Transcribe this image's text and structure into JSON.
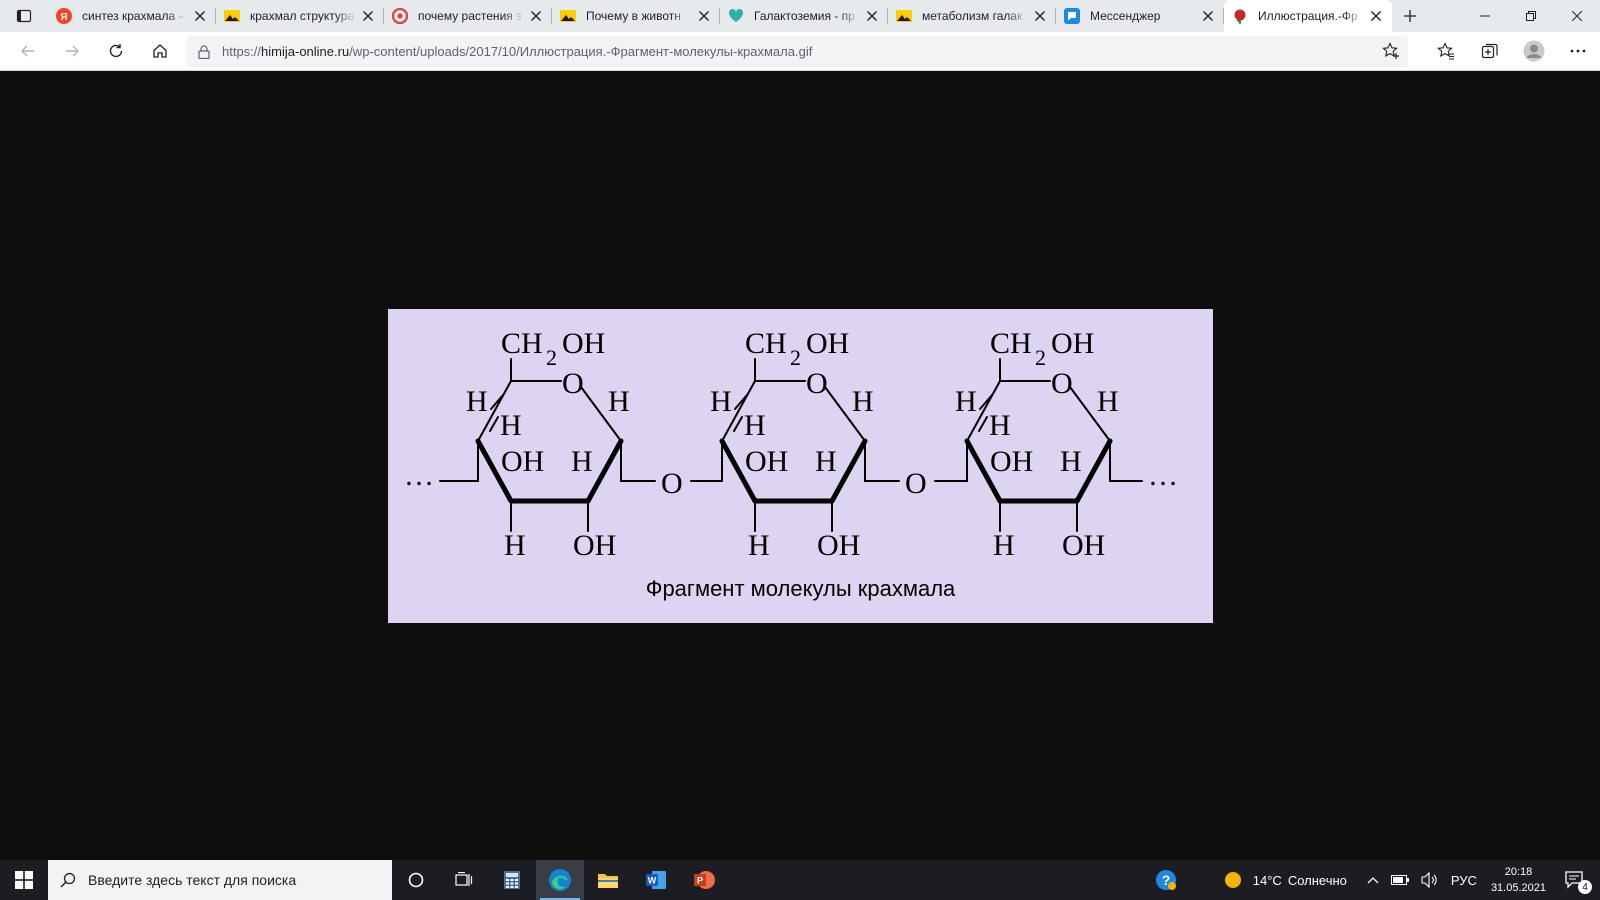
{
  "browser": {
    "tabs": [
      {
        "title": "синтез крахмала –",
        "favicon": "yandex-icon",
        "color": "#fc3f1d"
      },
      {
        "title": "крахмал структура",
        "favicon": "image-search-icon",
        "color": "#ffcc00"
      },
      {
        "title": "почему растения з",
        "favicon": "search-engine-icon",
        "color": "#e53935"
      },
      {
        "title": "Почему в животн",
        "favicon": "image-search-icon",
        "color": "#ffcc00"
      },
      {
        "title": "Галактоземия - пр",
        "favicon": "heart-icon",
        "color": "#2bb3a3"
      },
      {
        "title": "метаболизм галак",
        "favicon": "image-search-icon",
        "color": "#ffcc00"
      },
      {
        "title": "Мессенджер",
        "favicon": "messenger-icon",
        "color": "#1e88e5"
      },
      {
        "title": "Иллюстрация.-Фр",
        "favicon": "rose-icon",
        "color": "#c62828",
        "active": true
      }
    ],
    "url": {
      "scheme": "https://",
      "host": "himija-online.ru",
      "path": "/wp-content/uploads/2017/10/Иллюстрация.-Фрагмент-молекулы-крахмала.gif"
    }
  },
  "figure": {
    "background": "#dcd4f1",
    "labels": {
      "ch2oh": "CH",
      "sub2": "2",
      "oh": "OH",
      "h": "H",
      "o": "O",
      "dots": "…"
    },
    "caption": "Фрагмент молекулы крахмала"
  },
  "taskbar": {
    "search_placeholder": "Введите здесь текст для поиска",
    "weather": {
      "temp": "14°C",
      "condition": "Солнечно"
    },
    "language": "РУС",
    "time": "20:18",
    "date": "31.05.2021",
    "notifications": "4"
  }
}
